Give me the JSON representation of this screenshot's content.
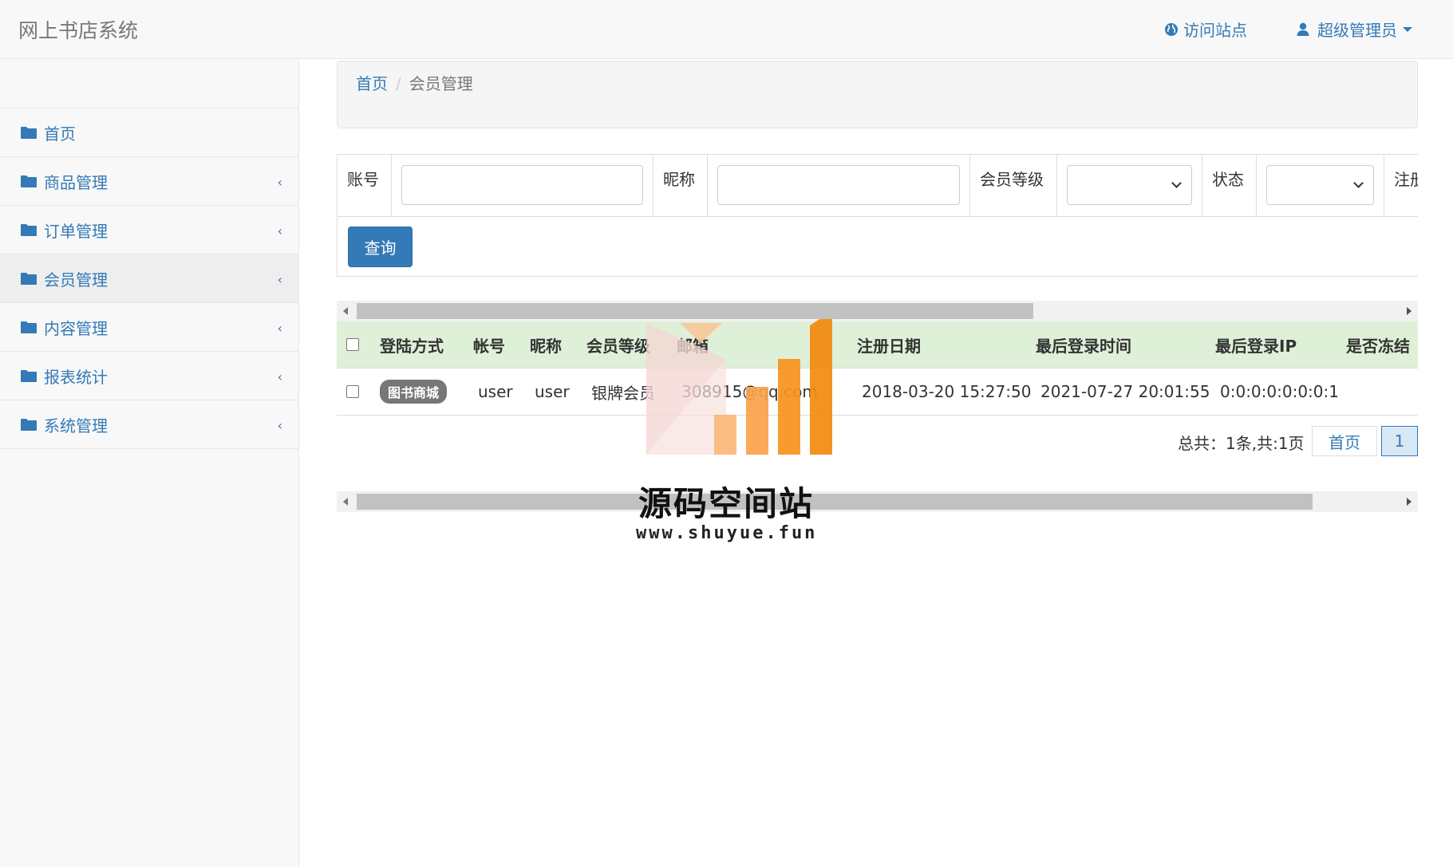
{
  "app": {
    "title": "网上书店系统",
    "visit_site": "访问站点",
    "user_menu": "超级管理员"
  },
  "sidebar": {
    "items": [
      {
        "label": "首页",
        "has_submenu": false,
        "active": false
      },
      {
        "label": "商品管理",
        "has_submenu": true,
        "active": false
      },
      {
        "label": "订单管理",
        "has_submenu": true,
        "active": false
      },
      {
        "label": "会员管理",
        "has_submenu": true,
        "active": true
      },
      {
        "label": "内容管理",
        "has_submenu": true,
        "active": false
      },
      {
        "label": "报表统计",
        "has_submenu": true,
        "active": false
      },
      {
        "label": "系统管理",
        "has_submenu": true,
        "active": false
      }
    ]
  },
  "breadcrumb": {
    "home": "首页",
    "current": "会员管理"
  },
  "filter": {
    "account_label": "账号",
    "account_value": "",
    "nickname_label": "昵称",
    "nickname_value": "",
    "level_label": "会员等级",
    "level_selected": "",
    "status_label": "状态",
    "status_selected": "",
    "register_label_partial": "注册",
    "query_button": "查询"
  },
  "table": {
    "headers": [
      "登陆方式",
      "帐号",
      "昵称",
      "会员等级",
      "邮箱",
      "注册日期",
      "最后登录时间",
      "最后登录IP",
      "是否冻结"
    ],
    "rows": [
      {
        "login_method": "图书商城",
        "account": "user",
        "nickname": "user",
        "level": "银牌会员",
        "email": "308915@qq.com",
        "register_date": "2018-03-20 15:27:50",
        "last_login": "2021-07-27 20:01:55",
        "last_ip": "0:0:0:0:0:0:0:1",
        "frozen": ""
      }
    ]
  },
  "pagination": {
    "summary": "总共：1条,共:1页",
    "first": "首页",
    "current_page": "1"
  },
  "watermark": {
    "title": "源码空间站",
    "url": "www.shuyue.fun"
  },
  "colors": {
    "link": "#337ab7",
    "header_row": "#dff0d8",
    "badge": "#777777",
    "watermark_orange": "#f7931e"
  }
}
